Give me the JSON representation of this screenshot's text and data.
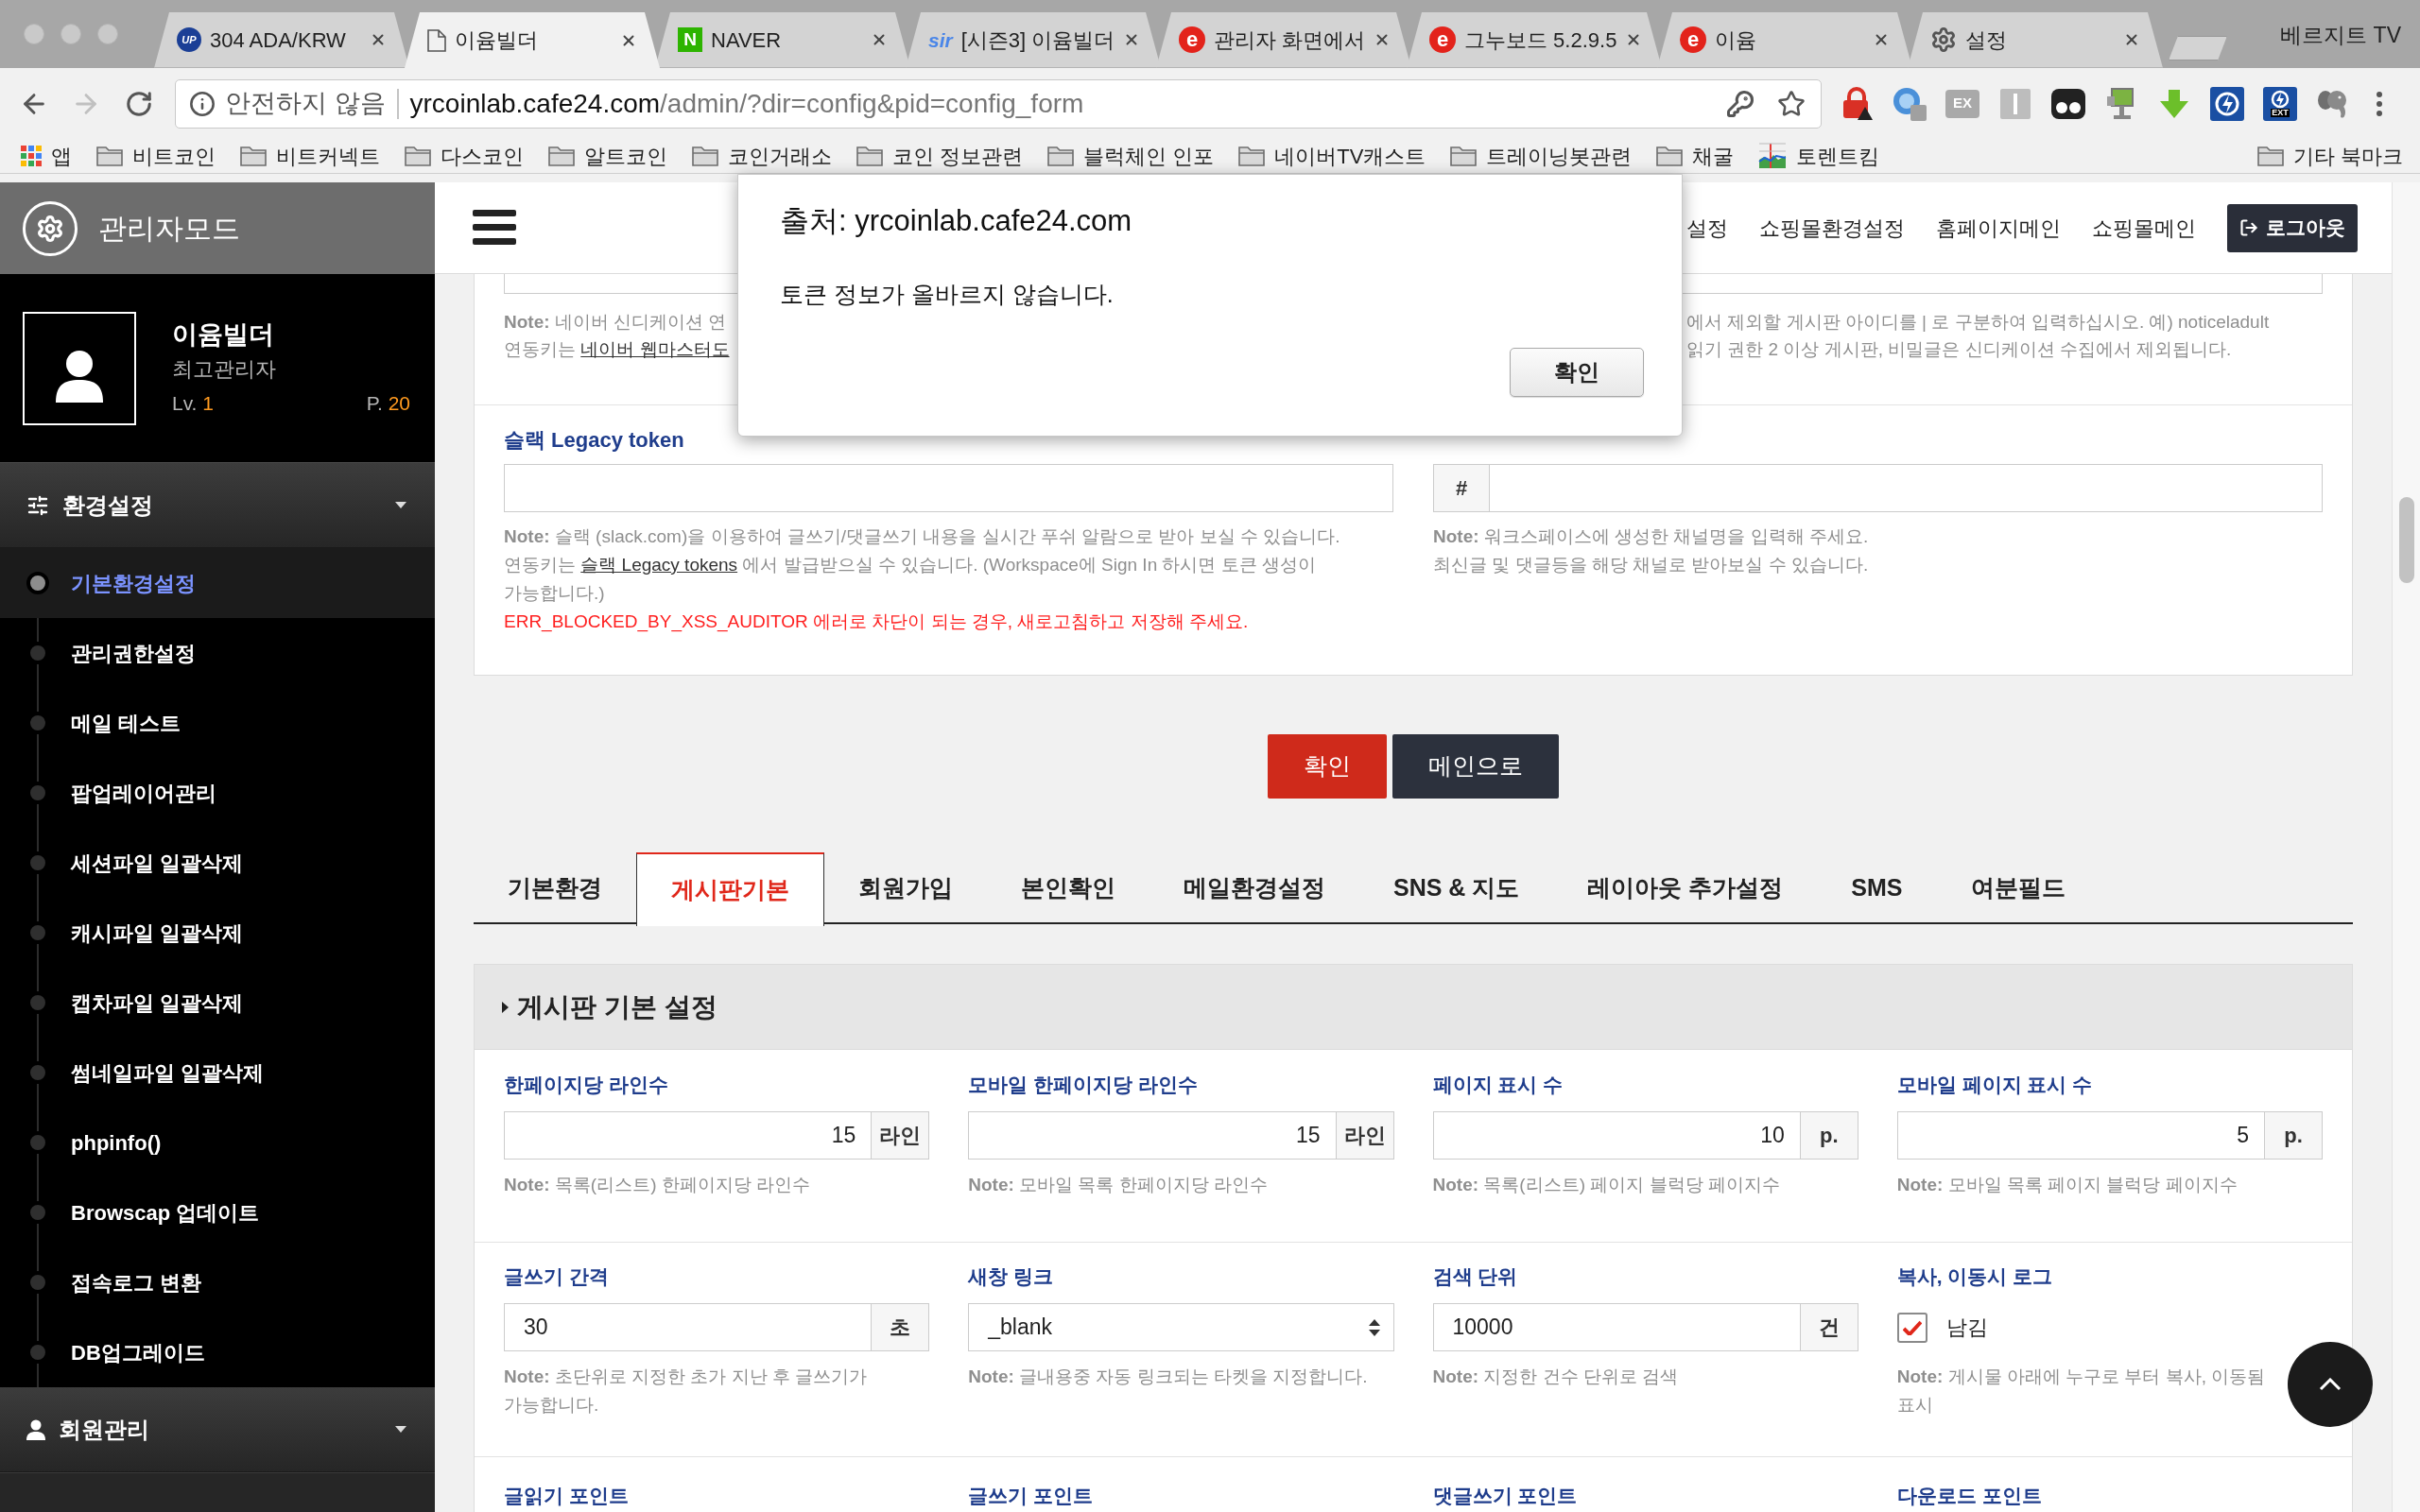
{
  "browser": {
    "tabs": [
      {
        "title": "304 ADA/KRW",
        "kind": "disc",
        "favicon_text": "UP",
        "selected": false
      },
      {
        "title": "이윰빌더",
        "kind": "page",
        "selected": true
      },
      {
        "title": "NAVER",
        "kind": "tile",
        "favicon_text": "N",
        "selected": false
      },
      {
        "title": "[시즌3] 이윰빌더",
        "kind": "script",
        "favicon_text": "sir",
        "selected": false
      },
      {
        "title": "관리자 화면에서",
        "kind": "badge",
        "favicon_text": "e",
        "selected": false
      },
      {
        "title": "그누보드 5.2.9.5",
        "kind": "badge",
        "favicon_text": "e",
        "selected": false
      },
      {
        "title": "이윰",
        "kind": "badge",
        "favicon_text": "e",
        "selected": false
      },
      {
        "title": "설정",
        "kind": "gear",
        "selected": false
      }
    ],
    "profile_name": "베르지트 TV",
    "address": {
      "security": "안전하지 않음",
      "host": "yrcoinlab.cafe24.com",
      "path": "/admin/?dir=config&pid=config_form"
    },
    "extensions": [
      {
        "kind": "lock"
      },
      {
        "kind": "globe"
      },
      {
        "kind": "label",
        "label": "EX"
      },
      {
        "kind": "reader"
      },
      {
        "kind": "mask"
      },
      {
        "kind": "monitor"
      },
      {
        "kind": "download"
      },
      {
        "kind": "bolt"
      },
      {
        "kind": "bolt",
        "label": "EXT"
      },
      {
        "kind": "elephant"
      }
    ],
    "bookmarks": [
      {
        "kind": "apps",
        "label": "앱"
      },
      {
        "kind": "folder",
        "label": "비트코인"
      },
      {
        "kind": "folder",
        "label": "비트커넥트"
      },
      {
        "kind": "folder",
        "label": "다스코인"
      },
      {
        "kind": "folder",
        "label": "알트코인"
      },
      {
        "kind": "folder",
        "label": "코인거래소"
      },
      {
        "kind": "folder",
        "label": "코인 정보관련"
      },
      {
        "kind": "folder",
        "label": "블럭체인 인포"
      },
      {
        "kind": "folder",
        "label": "네이버TV캐스트"
      },
      {
        "kind": "folder",
        "label": "트레이닝봇관련"
      },
      {
        "kind": "folder",
        "label": "채굴"
      },
      {
        "kind": "chart",
        "label": "토렌트킴"
      }
    ],
    "other_bookmarks": "기타 북마크"
  },
  "sidebar": {
    "title": "관리자모드",
    "profile": {
      "name": "이윰빌더",
      "role": "최고관리자",
      "lv_label": "Lv.",
      "lv": "1",
      "point_label": "P.",
      "point": "20"
    },
    "groups": [
      {
        "label": "환경설정",
        "kind": "sliders",
        "items": [
          {
            "label": "기본환경설정",
            "selected": true
          },
          {
            "label": "관리권한설정",
            "selected": false
          },
          {
            "label": "메일 테스트",
            "selected": false
          },
          {
            "label": "팝업레이어관리",
            "selected": false
          },
          {
            "label": "세션파일 일괄삭제",
            "selected": false
          },
          {
            "label": "캐시파일 일괄삭제",
            "selected": false
          },
          {
            "label": "캡차파일 일괄삭제",
            "selected": false
          },
          {
            "label": "썸네일파일 일괄삭제",
            "selected": false
          },
          {
            "label": "phpinfo()",
            "selected": false
          },
          {
            "label": "Browscap 업데이트",
            "selected": false
          },
          {
            "label": "접속로그 변환",
            "selected": false
          },
          {
            "label": "DB업그레이드",
            "selected": false
          }
        ]
      },
      {
        "label": "회원관리",
        "kind": "person"
      }
    ]
  },
  "header": {
    "nav": [
      "설정",
      "쇼핑몰환경설정",
      "홈페이지메인",
      "쇼핑몰메인"
    ],
    "logout": "로그아웃"
  },
  "upper_panel": {
    "first_row": {
      "left": {
        "lines": [
          "**Note:** 네이버 신디케이션 연"
        ],
        "link_line": {
          "before": "연동키는 ",
          "link": "네이버 웹마스터도"
        }
      },
      "right": {
        "lines": [
          "에서 제외할 게시판 아이디를 | 로 구분하여 입력하십시오. 예) noticeladult",
          "읽기 권한 2 이상 게시판, 비밀글은 신디케이션 수집에서 제외됩니다."
        ]
      }
    },
    "slack_token": {
      "label": "슬랙 Legacy token",
      "note": "**Note:** 슬랙 (slack.com)을 이용하여 글쓰기/댓글쓰기 내용을 실시간 푸쉬 알람으로 받아 보실 수 있습니다.",
      "link_line": {
        "before": "연동키는 ",
        "link": "슬랙 Legacy tokens",
        "after": " 에서 발급받으실 수 있습니다. (Workspace에 Sign In 하시면 토큰 생성이 가능합니다.)"
      },
      "warning": "ERR_BLOCKED_BY_XSS_AUDITOR 에러로 차단이 되는 경우, 새로고침하고 저장해 주세요."
    },
    "slack_channel": {
      "prefix": "#",
      "lines": [
        "**Note:** 워크스페이스에 생성한 채널명을 입력해 주세요.",
        "최신글 및 댓글등을 해당 채널로 받아보실 수 있습니다."
      ]
    }
  },
  "actions": [
    {
      "label": "확인",
      "kind": "primary"
    },
    {
      "label": "메인으로",
      "kind": "secondary"
    }
  ],
  "tabs": [
    {
      "label": "기본환경",
      "selected": false
    },
    {
      "label": "게시판기본",
      "selected": true
    },
    {
      "label": "회원가입",
      "selected": false
    },
    {
      "label": "본인확인",
      "selected": false
    },
    {
      "label": "메일환경설정",
      "selected": false
    },
    {
      "label": "SNS & 지도",
      "selected": false
    },
    {
      "label": "레이아웃 추가설정",
      "selected": false
    },
    {
      "label": "SMS",
      "selected": false
    },
    {
      "label": "여분필드",
      "selected": false
    }
  ],
  "board": {
    "title": "게시판 기본 설정",
    "rows": [
      [
        {
          "label": "한페이지당 라인수",
          "kind": "number",
          "value": "15",
          "unit": "라인",
          "note": "**Note:** 목록(리스트) 한페이지당 라인수"
        },
        {
          "label": "모바일 한페이지당 라인수",
          "kind": "number",
          "value": "15",
          "unit": "라인",
          "note": "**Note:** 모바일 목록 한페이지당 라인수"
        },
        {
          "label": "페이지 표시 수",
          "kind": "number",
          "value": "10",
          "unit": "p.",
          "note": "**Note:** 목록(리스트) 페이지 블럭당 페이지수"
        },
        {
          "label": "모바일 페이지 표시 수",
          "kind": "number",
          "value": "5",
          "unit": "p.",
          "note": "**Note:** 모바일 목록 페이지 블럭당 페이지수"
        }
      ],
      [
        {
          "label": "글쓰기 간격",
          "kind": "text",
          "value": "30",
          "unit": "초",
          "note": "**Note:** 초단위로 지정한 초가 지난 후 글쓰기가 가능합니다."
        },
        {
          "label": "새창 링크",
          "kind": "select",
          "value": "_blank",
          "note": "**Note:** 글내용중 자동 링크되는 타켓을 지정합니다."
        },
        {
          "label": "검색 단위",
          "kind": "text",
          "value": "10000",
          "unit": "건",
          "note": "**Note:** 지정한 건수 단위로 검색"
        },
        {
          "label": "복사, 이동시 로그",
          "kind": "checkbox",
          "option": "남김",
          "checked": true,
          "note": "**Note:** 게시물 아래에 누구로 부터 복사, 이동됨 표시"
        }
      ]
    ],
    "next_labels": [
      "글읽기 포인트",
      "글쓰기 포인트",
      "댓글쓰기 포인트",
      "다운로드 포인트"
    ]
  },
  "dialog": {
    "title": "출처: yrcoinlab.cafe24.com",
    "message": "토큰 정보가 올바르지 않습니다.",
    "button": "확인"
  }
}
